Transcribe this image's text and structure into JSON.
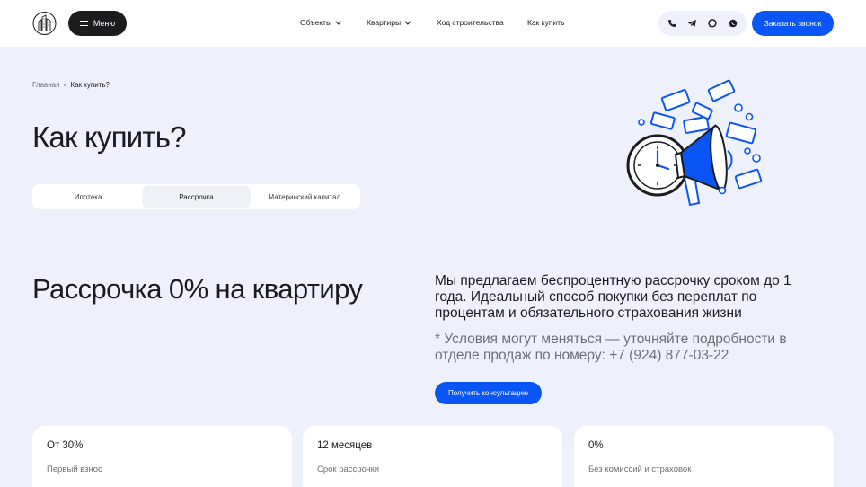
{
  "header": {
    "menu_label": "Меню",
    "nav": [
      {
        "label": "Объекты",
        "has_dropdown": true
      },
      {
        "label": "Квартиры",
        "has_dropdown": true
      },
      {
        "label": "Ход строительства",
        "has_dropdown": false
      },
      {
        "label": "Как купить",
        "has_dropdown": false
      }
    ],
    "contacts": [
      "phone-icon",
      "telegram-icon",
      "chat-icon",
      "whatsapp-icon"
    ],
    "call_button": "Заказать звонок"
  },
  "breadcrumb": {
    "home": "Главная",
    "current": "Как купить?"
  },
  "page_title": "Как купить?",
  "tabs": [
    {
      "label": "Ипотека",
      "active": false
    },
    {
      "label": "Рассрочка",
      "active": true
    },
    {
      "label": "Материнский капитал",
      "active": false
    }
  ],
  "section": {
    "title": "Рассрочка 0% на квартиру",
    "lead": "Мы предлагаем беспроцентную рассрочку сроком до 1 года. Идеальный способ покупки без переплат по процентам и обязательного страхования жизни",
    "note": "* Условия могут меняться — уточняйте подробности в отделе продаж по номеру: +7 (924) 877-03-22",
    "button": "Получить консультацию"
  },
  "cards": [
    {
      "value": "От 30%",
      "label": "Первый взнос"
    },
    {
      "value": "12 месяцев",
      "label": "Срок рассрочки"
    },
    {
      "value": "0%",
      "label": "Без комиссий и страховок"
    }
  ],
  "colors": {
    "accent": "#0a55f5",
    "background": "#eef1fb",
    "dark": "#1c1c1e"
  }
}
